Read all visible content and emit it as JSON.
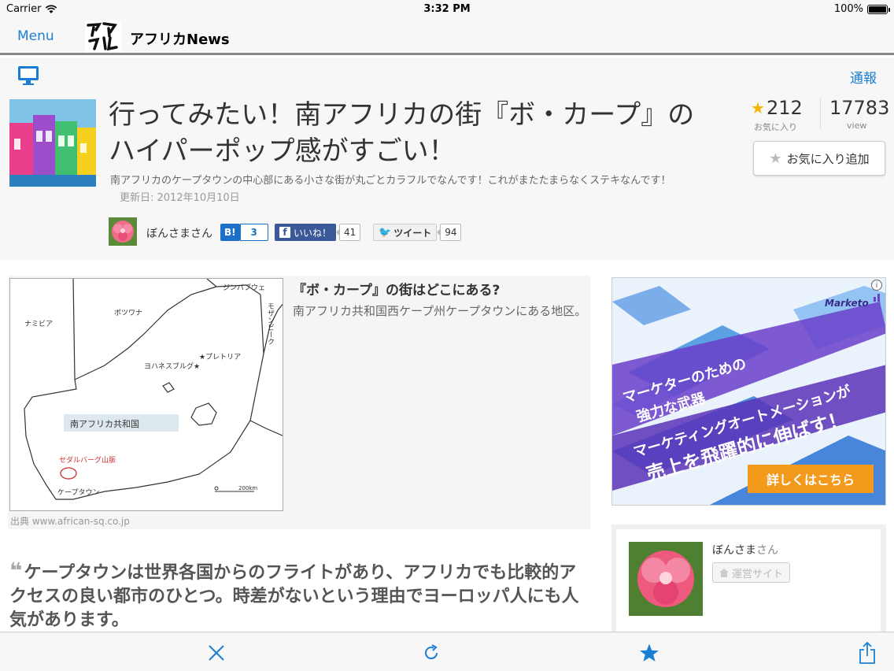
{
  "status_bar": {
    "carrier": "Carrier",
    "time": "3:32 PM",
    "battery": "100%"
  },
  "nav": {
    "menu_label": "Menu",
    "title": "アフリカNews"
  },
  "header": {
    "report_label": "通報",
    "title": "行ってみたい！南アフリカの街『ボ・カープ』のハイパーポップ感がすごい！",
    "description": "南アフリカのケープタウンの中心部にある小さな街が丸ごとカラフルでなんです！これがまたたまらなくステキなんです！",
    "updated": "更新日: 2012年10月10日",
    "favorites_count": "212",
    "favorites_label": "お気に入り",
    "views_count": "17783",
    "views_label": "view",
    "add_favorite_label": "お気に入り追加",
    "author_name": "ぼんさまさん",
    "share": {
      "hatena_label": "B!",
      "hatena_count": "3",
      "facebook_label": "いいね！",
      "facebook_count": "41",
      "twitter_label": "ツイート",
      "twitter_count": "94"
    }
  },
  "map_section": {
    "heading": "『ボ・カープ』の街はどこにある?",
    "text": "南アフリカ共和国西ケープ州ケープタウンにある地区。",
    "credit": "出典 www.african-sq.co.jp",
    "labels": {
      "zimbabwe": "ジンバブウェ",
      "mozambique": "モザンビーク",
      "namibia": "ナミビア",
      "botswana": "ボツワナ",
      "pretoria": "★プレトリア",
      "johannesburg": "ヨハネスブルグ★",
      "south_africa": "南アフリカ共和国",
      "cederberg": "セダルバーグ山脈",
      "capetown": "ケープタウン",
      "scale": "200km"
    }
  },
  "quote": "ケープタウンは世界各国からのフライトがあり、アフリカでも比較的アクセスの良い都市のひとつ。時差がないという理由でヨーロッパ人にも人気があります。",
  "ad": {
    "brand": "Marketo",
    "line1": "マーケターのための",
    "line2": "強力な武器",
    "line3": "マーケティングオートメーションが",
    "line4": "売上を飛躍的に伸ばす！",
    "cta": "詳しくはこちら"
  },
  "author_card": {
    "name": "ぼんさま",
    "suffix": "さん",
    "site_label": "運営サイト"
  }
}
